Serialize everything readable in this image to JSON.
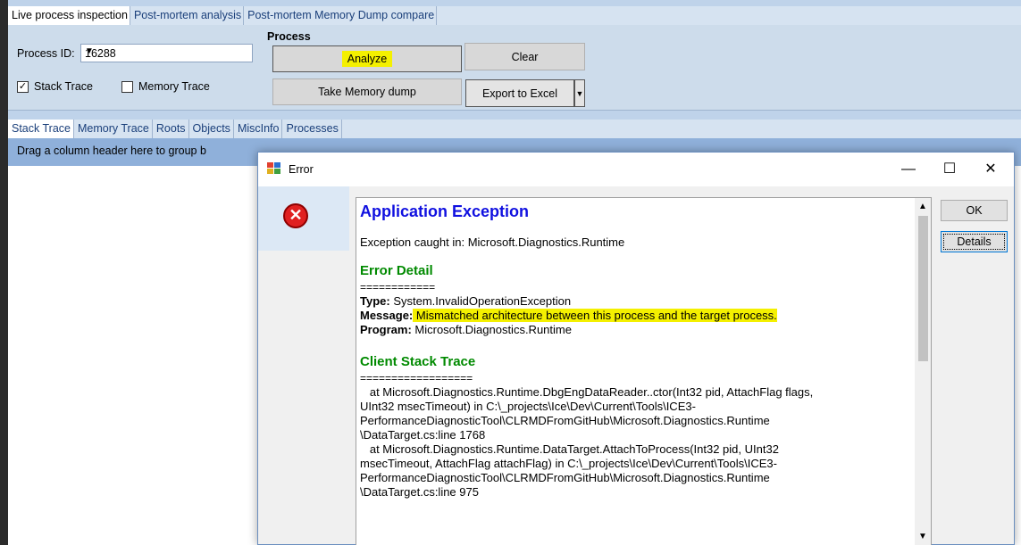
{
  "app": {
    "top_tabs": [
      "Live process inspection",
      "Post-mortem analysis",
      "Post-mortem Memory Dump compare"
    ],
    "process_id_label": "Process ID:",
    "process_id_value": "16288",
    "stack_trace_label": "Stack Trace",
    "memory_trace_label": "Memory Trace",
    "process_group_title": "Process",
    "analyze_label": "Analyze",
    "clear_label": "Clear",
    "take_dump_label": "Take Memory dump",
    "export_label": "Export to Excel",
    "sub_tabs": [
      "Stack Trace",
      "Memory Trace",
      "Roots",
      "Objects",
      "MiscInfo",
      "Processes"
    ],
    "group_header": "Drag a column header here to group b"
  },
  "dialog": {
    "title": "Error",
    "minimize_glyph": "—",
    "maximize_glyph": "☐",
    "close_glyph": "✕",
    "error_icon": "error-circle-x-icon",
    "ok_label": "OK",
    "details_label": "Details",
    "heading": "Application Exception",
    "caught_in": "Exception caught in: Microsoft.Diagnostics.Runtime",
    "error_detail_heading": "Error Detail",
    "sep1": "============",
    "type_label": "Type:",
    "type_value": " System.InvalidOperationException",
    "message_label": "Message:",
    "message_value": " Mismatched architecture between this process and the target process.",
    "program_label": "Program:",
    "program_value": " Microsoft.Diagnostics.Runtime",
    "client_stack_heading": "Client Stack Trace",
    "sep2": "==================",
    "stack_lines": [
      "   at Microsoft.Diagnostics.Runtime.DbgEngDataReader..ctor(Int32 pid, AttachFlag flags,",
      "UInt32 msecTimeout) in C:\\_projects\\Ice\\Dev\\Current\\Tools\\ICE3-",
      "PerformanceDiagnosticTool\\CLRMDFromGitHub\\Microsoft.Diagnostics.Runtime",
      "\\DataTarget.cs:line 1768",
      "   at Microsoft.Diagnostics.Runtime.DataTarget.AttachToProcess(Int32 pid, UInt32",
      "msecTimeout, AttachFlag attachFlag) in C:\\_projects\\Ice\\Dev\\Current\\Tools\\ICE3-",
      "PerformanceDiagnosticTool\\CLRMDFromGitHub\\Microsoft.Diagnostics.Runtime",
      "\\DataTarget.cs:line 975"
    ]
  }
}
